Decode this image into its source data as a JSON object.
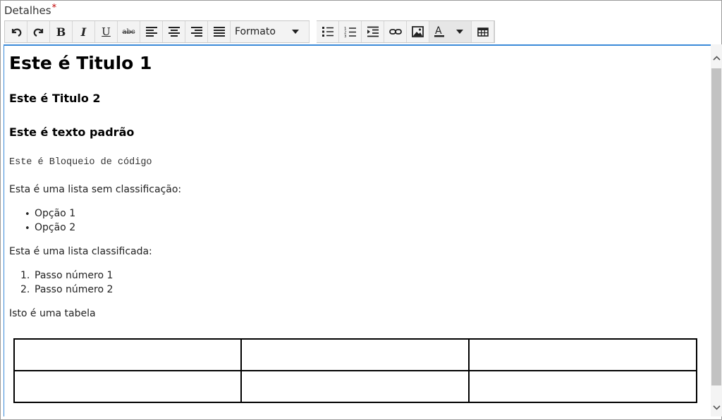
{
  "field": {
    "label": "Detalhes",
    "required_mark": "*"
  },
  "toolbar": {
    "buttons": [
      {
        "name": "undo-button",
        "icon": "undo-icon"
      },
      {
        "name": "redo-button",
        "icon": "redo-icon"
      },
      {
        "name": "bold-button",
        "label": "B"
      },
      {
        "name": "italic-button",
        "label": "I"
      },
      {
        "name": "underline-button",
        "label": "U"
      },
      {
        "name": "strikethrough-button",
        "label": "abc"
      },
      {
        "name": "align-left-button",
        "icon": "align-left-icon"
      },
      {
        "name": "align-center-button",
        "icon": "align-center-icon"
      },
      {
        "name": "align-right-button",
        "icon": "align-right-icon"
      },
      {
        "name": "align-justify-button",
        "icon": "align-justify-icon"
      }
    ],
    "format_label": "Formato",
    "list_buttons": [
      "bullet-list-icon",
      "numbered-list-icon",
      "indent-icon",
      "link-icon",
      "image-icon"
    ],
    "font_color_label": "A",
    "table_icon": "table-icon",
    "bold_label": "B",
    "italic_label": "I",
    "underline_label": "U",
    "strike_label": "abc"
  },
  "editor": {
    "heading1": "Este é Titulo 1",
    "heading2": "Este é Titulo 2",
    "heading3": "Este é texto padrão",
    "code_block": "Este é Bloqueio de código",
    "unordered_intro": "Esta é uma lista sem classificação:",
    "unordered_items": [
      "Opção 1",
      "Opção 2"
    ],
    "ordered_intro": "Esta é uma lista classificada:",
    "ordered_items": [
      "Passo número 1",
      "Passo número 2"
    ],
    "ordered_markers": [
      "1.",
      "2."
    ],
    "bullet_marker": "•",
    "table_intro": "Isto é uma tabela",
    "table": {
      "rows": 2,
      "cols": 3
    }
  },
  "colors": {
    "focus_border": "#3b8ad8",
    "required": "#c00000",
    "toolbar_bg": "#f3f3f3"
  }
}
